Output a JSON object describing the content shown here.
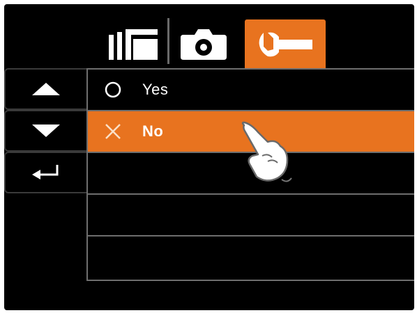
{
  "tabs": [
    {
      "name": "video",
      "icon": "video-mode-icon",
      "active": false
    },
    {
      "name": "photo",
      "icon": "camera-icon",
      "active": false
    },
    {
      "name": "setup",
      "icon": "wrench-icon",
      "active": true
    }
  ],
  "navigation": {
    "up_icon": "up-arrow-icon",
    "down_icon": "down-arrow-icon",
    "back_icon": "return-arrow-icon"
  },
  "options": [
    {
      "label": "Yes",
      "icon": "radio-empty-icon",
      "selected": false
    },
    {
      "label": "No",
      "icon": "x-mark-icon",
      "selected": true
    }
  ],
  "colors": {
    "accent": "#e8731f",
    "background": "#000000",
    "text": "#ffffff",
    "border": "#6e6e6e"
  }
}
